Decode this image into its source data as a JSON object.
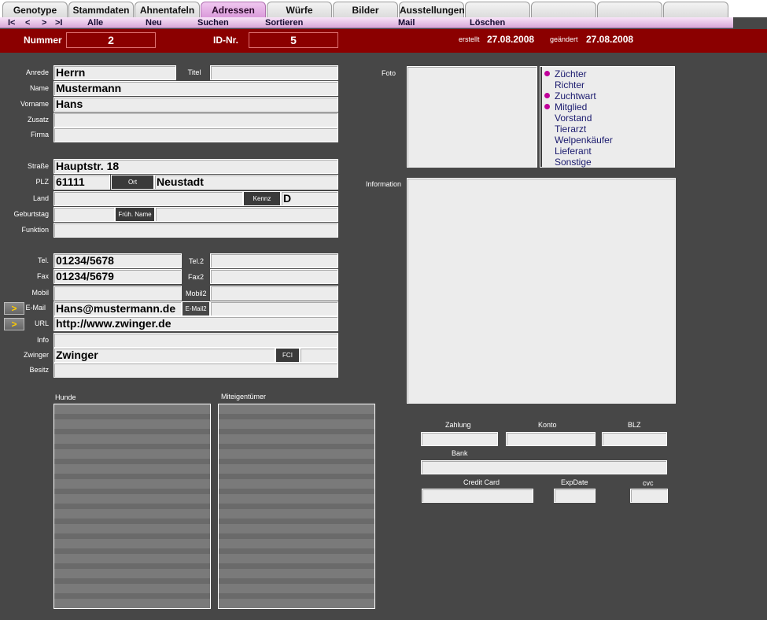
{
  "tabs": [
    "Genotype",
    "Stammdaten",
    "Ahnentafeln",
    "Adressen",
    "Würfe",
    "Bilder",
    "Ausstellungen",
    "",
    "",
    "",
    ""
  ],
  "active_tab": "Adressen",
  "nav": {
    "first": "I<",
    "prev": "<",
    "next": ">",
    "last": ">I",
    "alle": "Alle",
    "neu": "Neu",
    "suchen": "Suchen",
    "sortieren": "Sortieren",
    "mail": "Mail",
    "loeschen": "Löschen"
  },
  "header": {
    "nummer_label": "Nummer",
    "nummer": "2",
    "idnr_label": "ID-Nr.",
    "idnr": "5",
    "erstellt_label": "erstellt",
    "erstellt": "27.08.2008",
    "geaendert_label": "geändert",
    "geaendert": "27.08.2008"
  },
  "labels": {
    "anrede": "Anrede",
    "titel": "Titel",
    "name": "Name",
    "vorname": "Vorname",
    "zusatz": "Zusatz",
    "firma": "Firma",
    "strasse": "Straße",
    "plz": "PLZ",
    "ort": "Ort",
    "land": "Land",
    "kennz": "Kennz",
    "geburtstag": "Geburtstag",
    "frueh_name": "Früh. Name",
    "funktion": "Funktion",
    "tel": "Tel.",
    "tel2": "Tel.2",
    "fax": "Fax",
    "fax2": "Fax2",
    "mobil": "Mobil",
    "mobil2": "Mobil2",
    "email": "E-Mail",
    "email2": "E-Mail2",
    "url": "URL",
    "info": "Info",
    "zwinger": "Zwinger",
    "fci": "FCI",
    "besitz": "Besitz",
    "foto": "Foto",
    "information": "Information",
    "hunde": "Hunde",
    "miteigentuemer": "Miteigentümer",
    "zahlung": "Zahlung",
    "konto": "Konto",
    "blz": "BLZ",
    "bank": "Bank",
    "credit_card": "Credit Card",
    "exp_date": "ExpDate",
    "cvc": "cvc"
  },
  "values": {
    "anrede": "Herrn",
    "titel": "",
    "name": "Mustermann",
    "vorname": "Hans",
    "zusatz": "",
    "firma": "",
    "strasse": "Hauptstr. 18",
    "plz": "61111",
    "ort": "Neustadt",
    "land": "",
    "kennz": "D",
    "geburtstag": "",
    "frueh_name": "",
    "funktion": "",
    "tel": "01234/5678",
    "tel2": "",
    "fax": "01234/5679",
    "fax2": "",
    "mobil": "",
    "mobil2": "",
    "email": "Hans@mustermann.de",
    "email2": "",
    "url": "http://www.zwinger.de",
    "info": "",
    "zwinger": "Zwinger",
    "fci": "",
    "besitz": ""
  },
  "roles": [
    {
      "label": "Züchter",
      "checked": true
    },
    {
      "label": "Richter",
      "checked": false
    },
    {
      "label": "Zuchtwart",
      "checked": true
    },
    {
      "label": "Mitglied",
      "checked": true
    },
    {
      "label": "Vorstand",
      "checked": false
    },
    {
      "label": "Tierarzt",
      "checked": false
    },
    {
      "label": "Welpenkäufer",
      "checked": false
    },
    {
      "label": "Lieferant",
      "checked": false
    },
    {
      "label": "Sonstige",
      "checked": false
    }
  ],
  "arrow_glyph": ">",
  "colors": {
    "header_red": "#8b0000",
    "active_tab": "#d896d8",
    "role_dot": "#c0009a",
    "background": "#474747"
  }
}
